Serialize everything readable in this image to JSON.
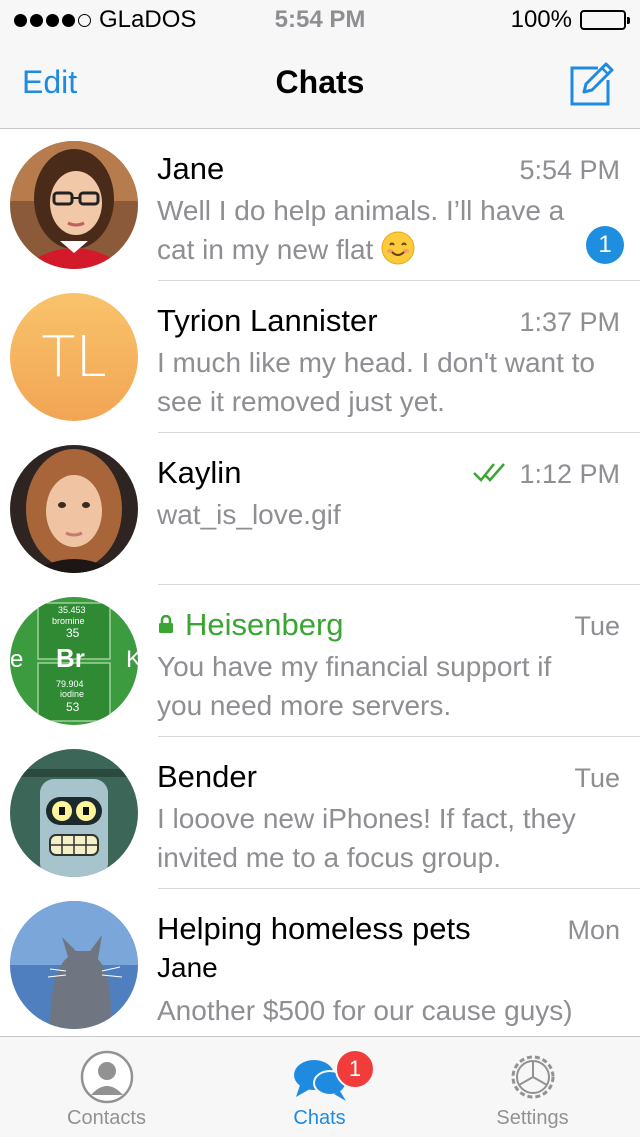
{
  "status_bar": {
    "carrier": "GLaDOS",
    "time": "5:54 PM",
    "battery": "100%"
  },
  "nav": {
    "edit_label": "Edit",
    "title": "Chats",
    "compose_icon": "compose-icon"
  },
  "chats": [
    {
      "name": "Jane",
      "time": "5:54 PM",
      "preview": "Well I do help animals. I’ll have a cat in my new flat",
      "emoji": "smiling-face",
      "unread": "1"
    },
    {
      "name": "Tyrion Lannister",
      "initials": "TL",
      "time": "1:37 PM",
      "preview": "I much like my head. I don't want to see it removed just yet."
    },
    {
      "name": "Kaylin",
      "time": "1:12 PM",
      "preview": "wat_is_love.gif",
      "status": "read"
    },
    {
      "name": "Heisenberg",
      "secret": true,
      "time": "Tue",
      "preview": "You have my financial support if you need more servers.",
      "avatar_text": {
        "top": "35.453",
        "element1": "bromine",
        "num1": "35",
        "symbol": "Br",
        "side_left": "e",
        "side_right": "K",
        "mid": "79.904",
        "element2": "iodine",
        "num2": "53"
      }
    },
    {
      "name": "Bender",
      "time": "Tue",
      "preview": "I looove new iPhones! If fact, they invited me to a focus group."
    },
    {
      "name": "Helping homeless pets",
      "time": "Mon",
      "sender": "Jane",
      "preview": "Another $500 for our cause guys)"
    }
  ],
  "tabs": [
    {
      "label": "Contacts",
      "icon": "contacts-icon"
    },
    {
      "label": "Chats",
      "icon": "chats-icon",
      "badge": "1"
    },
    {
      "label": "Settings",
      "icon": "settings-icon"
    }
  ],
  "colors": {
    "accent": "#1f8be0",
    "secret": "#3aa532",
    "badge": "#f23c3c",
    "secondary_text": "#8e8e93"
  }
}
